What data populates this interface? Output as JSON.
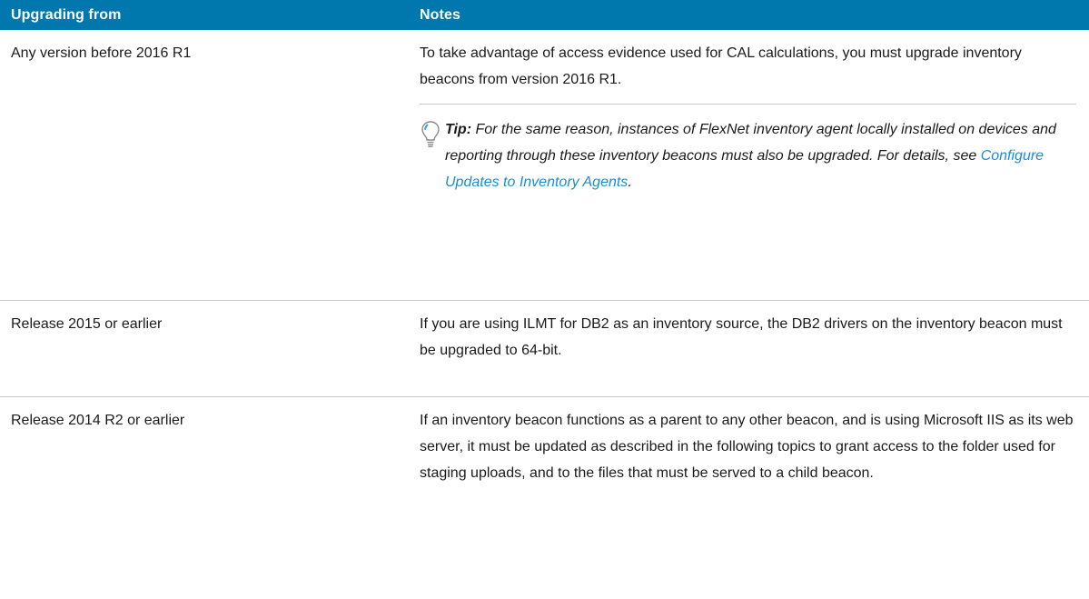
{
  "table": {
    "headers": {
      "upgrading_from": "Upgrading from",
      "notes": "Notes"
    },
    "rows": [
      {
        "from": "Any version before 2016 R1",
        "notes": "To take advantage of access evidence used for CAL calculations, you must upgrade inventory beacons from version 2016 R1.",
        "tip": {
          "label": "Tip:",
          "text": "For the same reason, instances of FlexNet inventory agent locally installed on devices and reporting through these inventory beacons must also be upgraded. For details, see",
          "link": "Configure Updates to Inventory Agents",
          "after": "."
        }
      },
      {
        "from": "Release 2015 or earlier",
        "notes": "If you are using ILMT for DB2 as an inventory source, the DB2 drivers on the inventory beacon must be upgraded to 64-bit."
      },
      {
        "from": "Release 2014 R2 or earlier",
        "notes": "If an inventory beacon functions as a parent to any other beacon, and is using Microsoft IIS as its web server, it must be updated as described in the following topics to grant access to the folder used for staging uploads, and to the files that must be served to a child beacon."
      }
    ]
  },
  "colors": {
    "header_bg": "#0078ae",
    "header_text": "#ffffff",
    "link": "#1a8cd8",
    "divider": "#c8c8c8"
  },
  "icons": {
    "tip": "lightbulb-icon"
  }
}
